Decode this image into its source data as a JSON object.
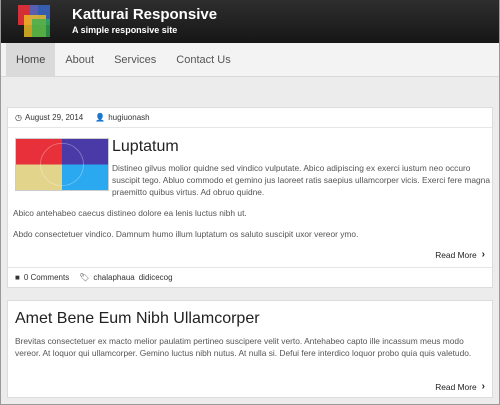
{
  "header": {
    "title": "Katturai Responsive",
    "tagline": "A simple responsive site"
  },
  "nav": {
    "items": [
      {
        "label": "Home"
      },
      {
        "label": "About"
      },
      {
        "label": "Services"
      },
      {
        "label": "Contact Us"
      }
    ]
  },
  "posts": [
    {
      "date": "August 29, 2014",
      "author": "hugiuonash",
      "title": "Luptatum",
      "excerpt1": "Distineo gilvus molior quidne sed vindico vulputate. Abico adipiscing ex exerci iustum neo occuro suscipit tego. Abluo commodo et gemino jus laoreet ratis saepius ullamcorper vicis. Exerci fere magna praemitto quibus virtus. Ad obruo quidne.",
      "excerpt2": "Abico antehabeo caecus distineo dolore ea lenis luctus nibh ut.",
      "excerpt3": "Abdo consectetuer vindico. Damnum humo illum luptatum os saluto suscipit uxor vereor ymo.",
      "read_more": "Read More",
      "comments": "0 Comments",
      "tags": [
        "chalaphaua",
        "didicecog"
      ]
    },
    {
      "title": "Amet Bene Eum Nibh Ullamcorper",
      "excerpt": "Brevitas consectetuer ex macto melior paulatim pertineo suscipere velit verto. Antehabeo capto ille incassum meus modo vereor. At loquor qui ullamcorper. Gemino luctus nibh nutus. At nulla si. Defui fere interdico loquor probo quia quis valetudo.",
      "read_more": "Read More"
    }
  ],
  "colors": {
    "header_bg": "#1e1e1e",
    "nav_active_bg": "#dadada",
    "thumb_red": "#e8303a",
    "thumb_blue": "#4a3aa8",
    "thumb_yellow": "#e2d48a",
    "thumb_cyan": "#2aa8f0"
  },
  "icons": {
    "date": "clock-icon",
    "author": "user-icon",
    "comments": "comment-icon",
    "tags": "tags-icon",
    "read_more": "chevron-right-icon"
  }
}
